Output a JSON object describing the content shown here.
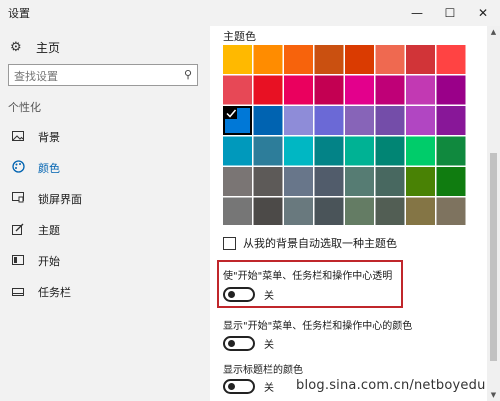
{
  "window": {
    "title": "设置",
    "min_glyph": "—",
    "max_glyph": "☐",
    "close_glyph": "✕"
  },
  "sidebar": {
    "home": {
      "icon": "gear-icon",
      "label": "主页"
    },
    "search": {
      "placeholder": "查找设置",
      "icon": "search-icon"
    },
    "section_label": "个性化",
    "items": [
      {
        "icon": "image-icon",
        "label": "背景",
        "active": false
      },
      {
        "icon": "palette-icon",
        "label": "颜色",
        "active": true
      },
      {
        "icon": "lock-screen-icon",
        "label": "锁屏界面",
        "active": false
      },
      {
        "icon": "brush-icon",
        "label": "主题",
        "active": false
      },
      {
        "icon": "start-icon",
        "label": "开始",
        "active": false
      },
      {
        "icon": "taskbar-icon",
        "label": "任务栏",
        "active": false
      }
    ]
  },
  "main": {
    "section_title": "主题色",
    "swatches": [
      [
        "#ffb900",
        "#ff8c00",
        "#f7630c",
        "#ca5010",
        "#da3b01",
        "#ef6950",
        "#d13438",
        "#ff4343"
      ],
      [
        "#e74856",
        "#e81123",
        "#ea005e",
        "#c30052",
        "#e3008c",
        "#bf0077",
        "#c239b3",
        "#9a0089"
      ],
      [
        "#0078d7",
        "#0063b1",
        "#8e8cd8",
        "#6b69d6",
        "#8764b8",
        "#744da9",
        "#b146c2",
        "#881798"
      ],
      [
        "#0099bc",
        "#2d7d9a",
        "#00b7c3",
        "#038387",
        "#00b294",
        "#018574",
        "#00cc6a",
        "#10893e"
      ],
      [
        "#7a7574",
        "#5d5a58",
        "#68768a",
        "#515c6b",
        "#567c73",
        "#486860",
        "#498205",
        "#107c10"
      ],
      [
        "#767676",
        "#4c4a48",
        "#69797e",
        "#4a5459",
        "#647c64",
        "#525e54",
        "#847545",
        "#7e735f"
      ]
    ],
    "selected_swatch": {
      "row": 2,
      "col": 0
    },
    "auto_color_label": "从我的背景自动选取一种主题色",
    "transparency": {
      "title": "使\"开始\"菜单、任务栏和操作中心透明",
      "state": "关"
    },
    "show_color_start": {
      "title": "显示\"开始\"菜单、任务栏和操作中心的颜色",
      "state": "关"
    },
    "show_color_titlebar": {
      "title": "显示标题栏的颜色",
      "state": "关"
    }
  },
  "watermark": "blog.sina.com.cn/netboyedu",
  "colors": {
    "accent": "#0063b1",
    "highlight_border": "#c0262b"
  }
}
